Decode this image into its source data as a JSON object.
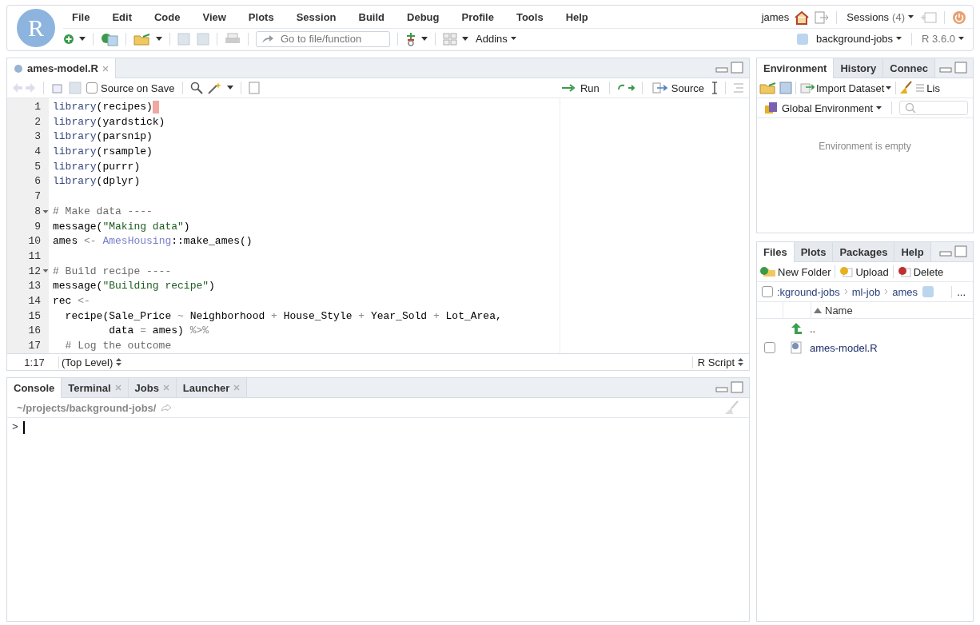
{
  "logo": {
    "letter": "R"
  },
  "menu": [
    "File",
    "Edit",
    "Code",
    "View",
    "Plots",
    "Session",
    "Build",
    "Debug",
    "Profile",
    "Tools",
    "Help"
  ],
  "user": {
    "name": "james",
    "sessions_label": "Sessions",
    "sessions_count": "(4)"
  },
  "toolbar": {
    "goto_placeholder": "Go to file/function",
    "addins": "Addins",
    "project": "background-jobs",
    "r_version": "R 3.6.0"
  },
  "editor": {
    "tabs": [
      {
        "label": "ames-model.R",
        "selected": true
      }
    ],
    "source_on_save": {
      "label": "Source on Save",
      "checked": false
    },
    "run": "Run",
    "source": "Source",
    "lines": [
      {
        "num": "1",
        "fold": false,
        "cursor": true,
        "tokens": [
          {
            "kind": "fn",
            "t": "library"
          },
          {
            "kind": "plain",
            "t": "(recipes)"
          }
        ]
      },
      {
        "num": "2",
        "fold": false,
        "cursor": false,
        "tokens": [
          {
            "kind": "fn",
            "t": "library"
          },
          {
            "kind": "plain",
            "t": "(yardstick)"
          }
        ]
      },
      {
        "num": "3",
        "fold": false,
        "cursor": false,
        "tokens": [
          {
            "kind": "fn",
            "t": "library"
          },
          {
            "kind": "plain",
            "t": "(parsnip)"
          }
        ]
      },
      {
        "num": "4",
        "fold": false,
        "cursor": false,
        "tokens": [
          {
            "kind": "fn",
            "t": "library"
          },
          {
            "kind": "plain",
            "t": "(rsample)"
          }
        ]
      },
      {
        "num": "5",
        "fold": false,
        "cursor": false,
        "tokens": [
          {
            "kind": "fn",
            "t": "library"
          },
          {
            "kind": "plain",
            "t": "(purrr)"
          }
        ]
      },
      {
        "num": "6",
        "fold": false,
        "cursor": false,
        "tokens": [
          {
            "kind": "fn",
            "t": "library"
          },
          {
            "kind": "plain",
            "t": "(dplyr)"
          }
        ]
      },
      {
        "num": "7",
        "fold": false,
        "cursor": false
      },
      {
        "num": "8",
        "fold": true,
        "cursor": false,
        "tokens": [
          {
            "kind": "comment",
            "t": "# Make data ----"
          }
        ]
      },
      {
        "num": "9",
        "fold": false,
        "cursor": false,
        "tokens": [
          {
            "kind": "plain",
            "t": "message("
          },
          {
            "kind": "str",
            "t": "\"Making data\""
          },
          {
            "kind": "plain",
            "t": ")"
          }
        ]
      },
      {
        "num": "10",
        "fold": false,
        "cursor": false,
        "tokens": [
          {
            "kind": "plain",
            "t": "ames "
          },
          {
            "kind": "op",
            "t": "<- "
          },
          {
            "kind": "ns",
            "t": "AmesHousing"
          },
          {
            "kind": "plain",
            "t": "::make_ames()"
          }
        ]
      },
      {
        "num": "11",
        "fold": false,
        "cursor": false
      },
      {
        "num": "12",
        "fold": true,
        "cursor": false,
        "tokens": [
          {
            "kind": "comment",
            "t": "# Build recipe ----"
          }
        ]
      },
      {
        "num": "13",
        "fold": false,
        "cursor": false,
        "tokens": [
          {
            "kind": "plain",
            "t": "message("
          },
          {
            "kind": "str",
            "t": "\"Building recipe\""
          },
          {
            "kind": "plain",
            "t": ")"
          }
        ]
      },
      {
        "num": "14",
        "fold": false,
        "cursor": false,
        "tokens": [
          {
            "kind": "plain",
            "t": "rec "
          },
          {
            "kind": "op",
            "t": "<-"
          }
        ]
      },
      {
        "num": "15",
        "fold": false,
        "cursor": false,
        "tokens": [
          {
            "kind": "plain",
            "t": "  recipe(Sale_Price "
          },
          {
            "kind": "op",
            "t": "~"
          },
          {
            "kind": "plain",
            "t": " Neighborhood "
          },
          {
            "kind": "op",
            "t": "+"
          },
          {
            "kind": "plain",
            "t": " House_Style "
          },
          {
            "kind": "op",
            "t": "+"
          },
          {
            "kind": "plain",
            "t": " Year_Sold "
          },
          {
            "kind": "op",
            "t": "+"
          },
          {
            "kind": "plain",
            "t": " Lot_Area,"
          }
        ]
      },
      {
        "num": "16",
        "fold": false,
        "cursor": false,
        "tokens": [
          {
            "kind": "plain",
            "t": "         data "
          },
          {
            "kind": "op",
            "t": "="
          },
          {
            "kind": "plain",
            "t": " ames) "
          },
          {
            "kind": "op",
            "t": "%>%"
          }
        ]
      },
      {
        "num": "17",
        "fold": false,
        "cursor": false,
        "tokens": [
          {
            "kind": "comment",
            "t": "  # Log the outcome"
          }
        ]
      }
    ],
    "status": {
      "position": "1:17",
      "scope": "(Top Level)",
      "filetype": "R Script"
    }
  },
  "console": {
    "tabs": [
      {
        "label": "Console",
        "selected": true,
        "closable": false
      },
      {
        "label": "Terminal",
        "selected": false,
        "closable": true
      },
      {
        "label": "Jobs",
        "selected": false,
        "closable": true
      },
      {
        "label": "Launcher",
        "selected": false,
        "closable": true
      }
    ],
    "path": "~/projects/background-jobs/",
    "prompt": ">"
  },
  "environment": {
    "tabs": [
      {
        "label": "Environment",
        "selected": true
      },
      {
        "label": "History",
        "selected": false
      },
      {
        "label": "Connec",
        "selected": false
      }
    ],
    "import": "Import Dataset",
    "list": "Lis",
    "scope": "Global Environment",
    "empty": "Environment is empty"
  },
  "files": {
    "tabs": [
      {
        "label": "Files",
        "selected": true
      },
      {
        "label": "Plots",
        "selected": false
      },
      {
        "label": "Packages",
        "selected": false
      },
      {
        "label": "Help",
        "selected": false
      }
    ],
    "new_folder": "New Folder",
    "upload": "Upload",
    "delete": "Delete",
    "select_all_checked": false,
    "breadcrumb": [
      ":kground-jobs",
      "ml-job",
      "ames"
    ],
    "more": "...",
    "column": "Name",
    "rows": [
      {
        "kind": "up",
        "name": ".."
      },
      {
        "kind": "file",
        "name": "ames-model.R",
        "checked": false
      }
    ]
  }
}
